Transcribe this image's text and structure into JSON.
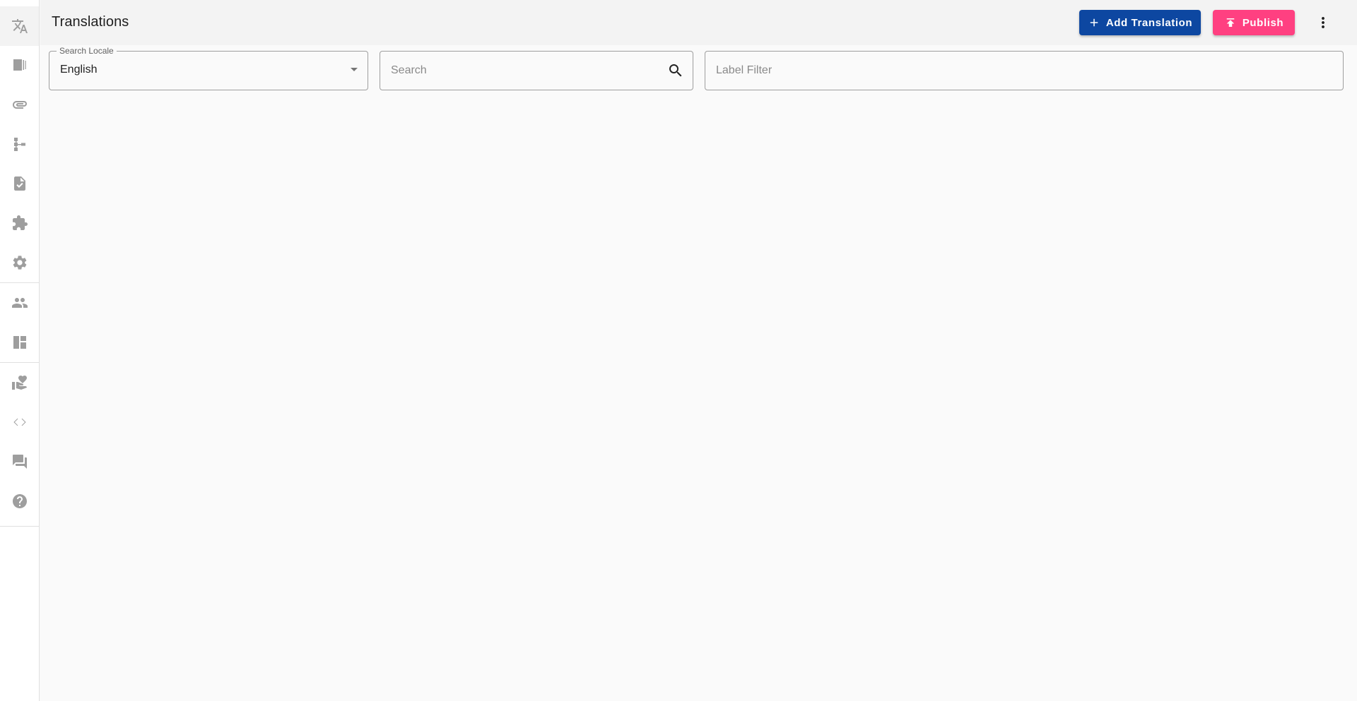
{
  "header": {
    "title": "Translations",
    "add_translation_label": "Add Translation",
    "publish_label": "Publish"
  },
  "sidebar": {
    "items": [
      {
        "icon": "translate-icon",
        "active": true
      },
      {
        "icon": "book-icon"
      },
      {
        "icon": "paperclip-icon"
      },
      {
        "icon": "hierarchy-icon"
      },
      {
        "icon": "document-check-icon"
      },
      {
        "icon": "puzzle-icon"
      },
      {
        "icon": "gear-icon"
      },
      {
        "icon": "people-icon"
      },
      {
        "icon": "dashboard-icon"
      },
      {
        "icon": "volunteer-heart-icon"
      },
      {
        "icon": "code-icon"
      },
      {
        "icon": "forum-icon"
      },
      {
        "icon": "help-icon"
      }
    ]
  },
  "filters": {
    "locale": {
      "label": "Search Locale",
      "value": "English"
    },
    "search": {
      "placeholder": "Search",
      "value": ""
    },
    "label_filter": {
      "placeholder": "Label Filter",
      "value": ""
    }
  },
  "colors": {
    "primary": "#0d47a1",
    "accent": "#ff4081"
  }
}
